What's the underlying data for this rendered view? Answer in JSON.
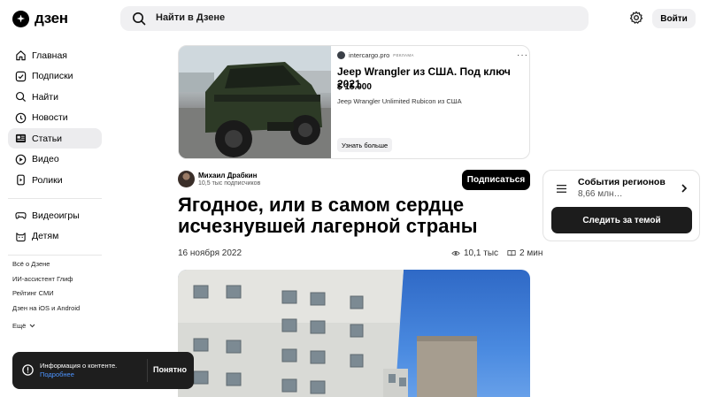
{
  "header": {
    "logo_text": "дзен",
    "search_placeholder": "Найти в Дзене",
    "login_label": "Войти"
  },
  "sidebar": {
    "items": [
      {
        "label": "Главная",
        "icon": "home-icon"
      },
      {
        "label": "Подписки",
        "icon": "subscriptions-icon"
      },
      {
        "label": "Найти",
        "icon": "search-icon"
      },
      {
        "label": "Новости",
        "icon": "news-icon"
      },
      {
        "label": "Статьи",
        "icon": "articles-icon",
        "active": true
      },
      {
        "label": "Видео",
        "icon": "video-icon"
      },
      {
        "label": "Ролики",
        "icon": "shorts-icon"
      }
    ],
    "items2": [
      {
        "label": "Видеоигры",
        "icon": "gamepad-icon"
      },
      {
        "label": "Детям",
        "icon": "kids-icon"
      }
    ],
    "links": [
      "Всё о Дзене",
      "ИИ-ассистент Глиф",
      "Рейтинг СМИ",
      "Дзен на iOS и Android"
    ],
    "more_label": "Ещё"
  },
  "ad": {
    "source": "intercargo.pro",
    "tag": "РЕКЛАМА",
    "title": "Jeep Wrangler из США. Под ключ 2021",
    "price": "$ 15.000",
    "description": "Jeep Wrangler Unlimited Rubicon из США",
    "button_label": "Узнать больше"
  },
  "author": {
    "name": "Михаил Драбкин",
    "subscribers": "10,5 тыс подписчиков",
    "subscribe_label": "Подписаться"
  },
  "article": {
    "title": "Ягодное, или в самом сердце исчезнувшей лагерной страны",
    "date": "16 ноября 2022",
    "views": "10,1 тыс",
    "read_time": "2 мин"
  },
  "widget": {
    "title": "События регионов",
    "subtitle": "8,66 млн…",
    "button_label": "Следить за темой"
  },
  "toast": {
    "text": "Информация о контенте.",
    "link": "Подробнее",
    "button_label": "Понятно"
  },
  "colors": {
    "accent": "#000000",
    "link": "#4c94ff",
    "active_bg": "#ececee"
  }
}
